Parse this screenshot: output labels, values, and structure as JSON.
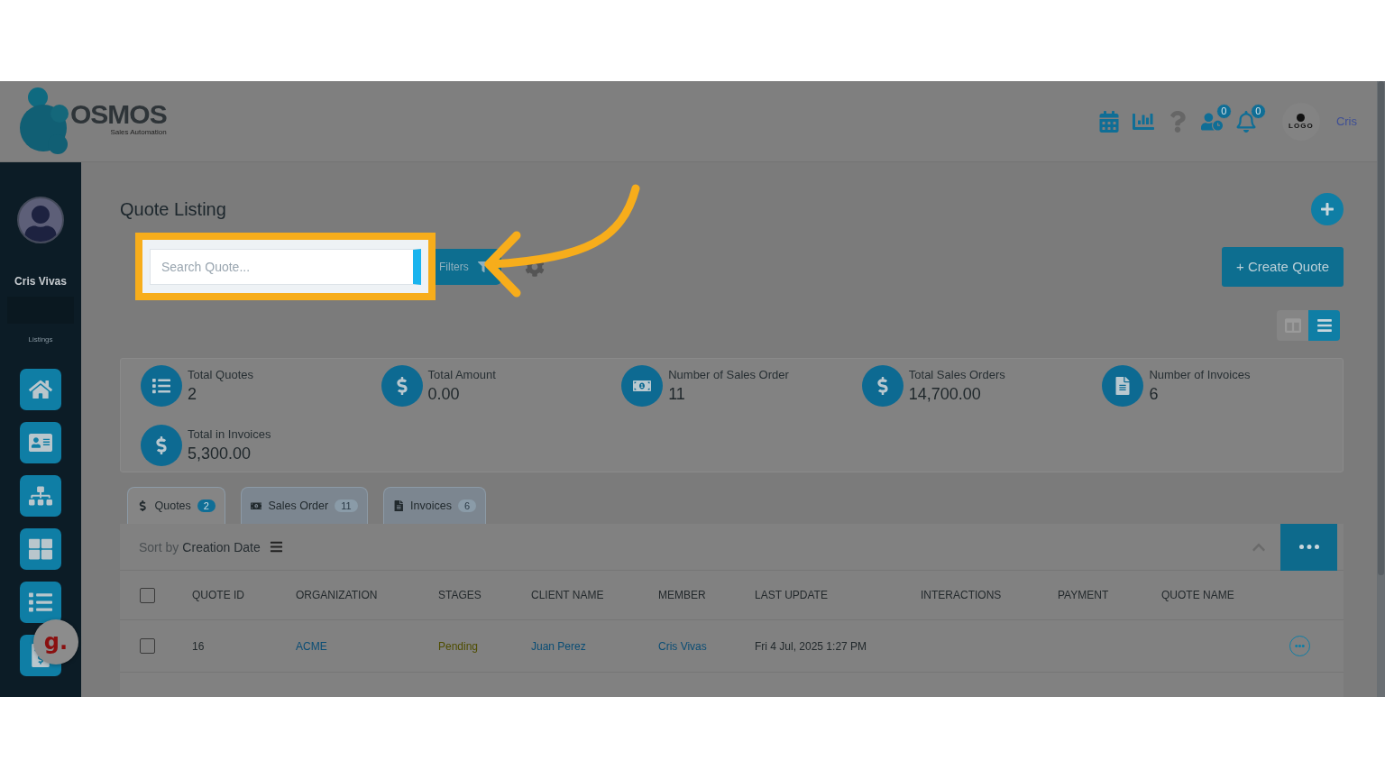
{
  "header": {
    "logo_name": "OSMOS",
    "logo_tagline": "Sales Automation",
    "badges": [
      "0",
      "0"
    ],
    "company_logo": "LOGO",
    "user": "Cris"
  },
  "sidebar": {
    "user_name": "Cris Vivas",
    "section": "Listings"
  },
  "floating_badge": "g.",
  "page_title": "Quote Listing",
  "search": {
    "placeholder": "Search Quote...",
    "highlighted": true
  },
  "filters_button": "Filters",
  "create_button": "+ Create Quote",
  "view_toggle": [
    {
      "selected": false
    },
    {
      "selected": true
    }
  ],
  "stats": [
    {
      "label": "Total Quotes",
      "value": "2"
    },
    {
      "label": "Total Amount",
      "value": "0.00"
    },
    {
      "label": "Number of Sales Order",
      "value": "11"
    },
    {
      "label": "Total Sales Orders",
      "value": "14,700.00"
    },
    {
      "label": "Number of Invoices",
      "value": "6"
    },
    {
      "label": "Total in Invoices",
      "value": "5,300.00"
    }
  ],
  "tabs": [
    {
      "label": "Quotes",
      "count": "2",
      "selected": true
    },
    {
      "label": "Sales Order",
      "count": "11",
      "selected": false
    },
    {
      "label": "Invoices",
      "count": "6",
      "selected": false
    }
  ],
  "sort": {
    "prefix": "Sort by",
    "field": "Creation Date"
  },
  "table": {
    "header_checked": false,
    "columns": [
      "QUOTE ID",
      "ORGANIZATION",
      "STAGES",
      "CLIENT NAME",
      "MEMBER",
      "LAST UPDATE",
      "INTERACTIONS",
      "PAYMENT",
      "QUOTE NAME"
    ],
    "rows": [
      {
        "checked": false,
        "cells": [
          "16",
          "ACME",
          "Pending",
          "Juan Perez",
          "Cris Vivas",
          "Fri 4 Jul, 2025 1:27 PM"
        ]
      }
    ]
  }
}
